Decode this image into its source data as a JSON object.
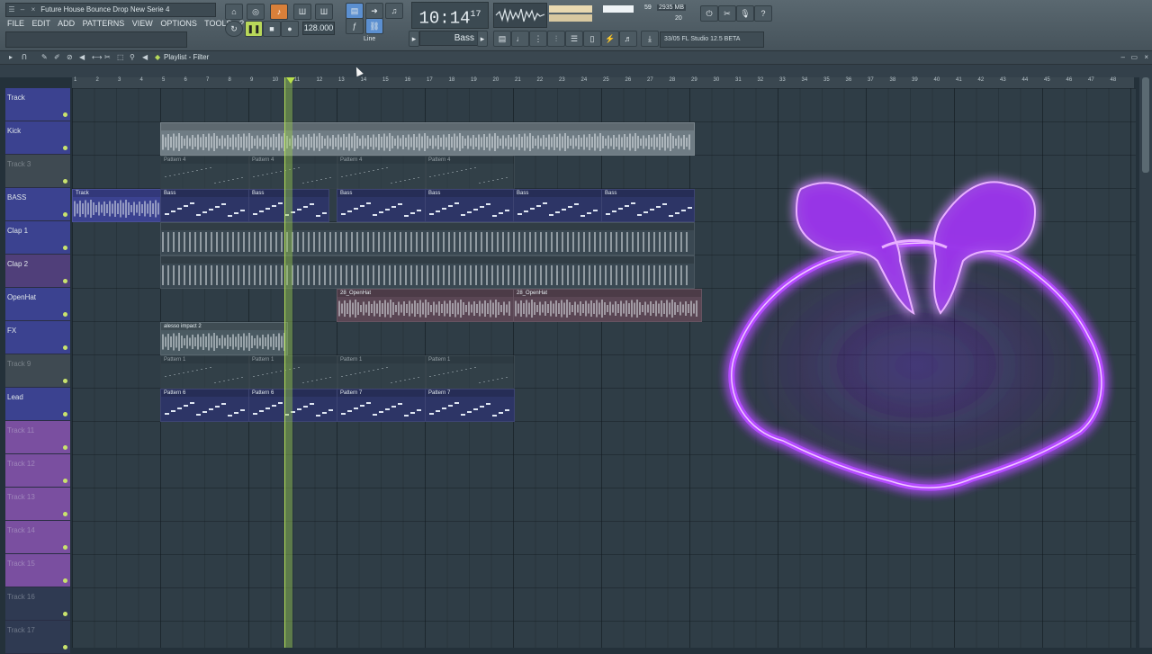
{
  "window": {
    "title": "Future House Bounce Drop New Serie 4"
  },
  "menu": [
    "FILE",
    "EDIT",
    "ADD",
    "PATTERNS",
    "VIEW",
    "OPTIONS",
    "TOOLS",
    "?"
  ],
  "transport": {
    "mode_label": "PAT",
    "tempo": "128.000",
    "snap": "Line"
  },
  "clock": {
    "main": "10:14",
    "sub": "17"
  },
  "pattern_selector": {
    "value": "Bass"
  },
  "cpu": {
    "cpu": "59",
    "memory": "2935 MB",
    "polyphony": "20"
  },
  "version": {
    "text": "33/05 FL Studio 12.5 BETA"
  },
  "playlist": {
    "title": "Playlist - Filter"
  },
  "ruler": [
    "1",
    "2",
    "3",
    "4",
    "5",
    "6",
    "7",
    "8",
    "9",
    "10",
    "11",
    "12",
    "13",
    "14",
    "15",
    "16",
    "17",
    "18",
    "19",
    "20",
    "21",
    "22",
    "23",
    "24",
    "25",
    "26",
    "27",
    "28",
    "29",
    "30",
    "31",
    "32",
    "33",
    "34",
    "35",
    "36",
    "37",
    "38",
    "39",
    "40",
    "41",
    "42",
    "43",
    "44",
    "45",
    "46",
    "47",
    "48"
  ],
  "tracks": [
    {
      "name": "Track",
      "color": "#3b4290"
    },
    {
      "name": "Kick",
      "color": "#3b4290"
    },
    {
      "name": "Track 3",
      "color": "#3f4a52"
    },
    {
      "name": "BASS",
      "color": "#3b4290"
    },
    {
      "name": "Clap 1",
      "color": "#3b4290"
    },
    {
      "name": "Clap 2",
      "color": "#503f7a"
    },
    {
      "name": "OpenHat",
      "color": "#3b4290"
    },
    {
      "name": "FX",
      "color": "#3b4290"
    },
    {
      "name": "Track 9",
      "color": "#3f4a52"
    },
    {
      "name": "Lead",
      "color": "#3b4290"
    },
    {
      "name": "Track 11",
      "color": "#7a4fa0"
    },
    {
      "name": "Track 12",
      "color": "#7a4fa0"
    },
    {
      "name": "Track 13",
      "color": "#7a4fa0"
    },
    {
      "name": "Track 14",
      "color": "#7a4fa0"
    },
    {
      "name": "Track 15",
      "color": "#7a4fa0"
    },
    {
      "name": "Track 16",
      "color": "#2f3a52"
    },
    {
      "name": "Track 17",
      "color": "#2f3a52"
    }
  ],
  "clips": [
    {
      "row": 1,
      "start": 178,
      "width": 592,
      "label": "",
      "kind": "audio",
      "color": "#6f7c84"
    },
    {
      "row": 2,
      "start": 178,
      "width": 98,
      "label": "Pattern 4",
      "kind": "pattern",
      "color": "#36434b"
    },
    {
      "row": 2,
      "start": 276,
      "width": 98,
      "label": "Pattern 4",
      "kind": "pattern",
      "color": "#36434b"
    },
    {
      "row": 2,
      "start": 374,
      "width": 98,
      "label": "Pattern 4",
      "kind": "pattern",
      "color": "#36434b"
    },
    {
      "row": 2,
      "start": 472,
      "width": 98,
      "label": "Pattern 4",
      "kind": "pattern",
      "color": "#36434b"
    },
    {
      "row": 3,
      "start": 80,
      "width": 98,
      "label": "Track",
      "kind": "audio",
      "color": "#3b4290"
    },
    {
      "row": 3,
      "start": 178,
      "width": 98,
      "label": "Bass",
      "kind": "notes",
      "color": "#2d3566"
    },
    {
      "row": 3,
      "start": 276,
      "width": 88,
      "label": "Bass",
      "kind": "notes",
      "color": "#2d3566"
    },
    {
      "row": 3,
      "start": 374,
      "width": 98,
      "label": "Bass",
      "kind": "notes",
      "color": "#2d3566"
    },
    {
      "row": 3,
      "start": 472,
      "width": 98,
      "label": "Bass",
      "kind": "notes",
      "color": "#2d3566"
    },
    {
      "row": 3,
      "start": 570,
      "width": 98,
      "label": "Bass",
      "kind": "notes",
      "color": "#2d3566"
    },
    {
      "row": 3,
      "start": 668,
      "width": 102,
      "label": "Bass",
      "kind": "notes",
      "color": "#2d3566"
    },
    {
      "row": 4,
      "start": 178,
      "width": 592,
      "label": "",
      "kind": "audio-hits",
      "color": "#3a4852"
    },
    {
      "row": 5,
      "start": 178,
      "width": 592,
      "label": "",
      "kind": "audio-hits",
      "color": "#3a4852"
    },
    {
      "row": 6,
      "start": 374,
      "width": 196,
      "label": "28_OpenHat",
      "kind": "audio",
      "color": "#5a4654"
    },
    {
      "row": 6,
      "start": 570,
      "width": 208,
      "label": "28_OpenHat",
      "kind": "audio",
      "color": "#5a4654"
    },
    {
      "row": 7,
      "start": 178,
      "width": 140,
      "label": "alesso impact 2",
      "kind": "audio",
      "color": "#4a5a62"
    },
    {
      "row": 8,
      "start": 178,
      "width": 98,
      "label": "Pattern 1",
      "kind": "pattern",
      "color": "#36434b"
    },
    {
      "row": 8,
      "start": 276,
      "width": 98,
      "label": "Pattern 1",
      "kind": "pattern",
      "color": "#36434b"
    },
    {
      "row": 8,
      "start": 374,
      "width": 98,
      "label": "Pattern 1",
      "kind": "pattern",
      "color": "#36434b"
    },
    {
      "row": 8,
      "start": 472,
      "width": 98,
      "label": "Pattern 1",
      "kind": "pattern",
      "color": "#36434b"
    },
    {
      "row": 9,
      "start": 178,
      "width": 98,
      "label": "Pattern 6",
      "kind": "notes",
      "color": "#2d3566"
    },
    {
      "row": 9,
      "start": 276,
      "width": 98,
      "label": "Pattern 6",
      "kind": "notes",
      "color": "#2d3566"
    },
    {
      "row": 9,
      "start": 374,
      "width": 98,
      "label": "Pattern 7",
      "kind": "notes",
      "color": "#2d3566"
    },
    {
      "row": 9,
      "start": 472,
      "width": 98,
      "label": "Pattern 7",
      "kind": "notes",
      "color": "#2d3566"
    }
  ],
  "colors": {
    "accent": "#a03cff",
    "playhead": "#b5e05a"
  }
}
